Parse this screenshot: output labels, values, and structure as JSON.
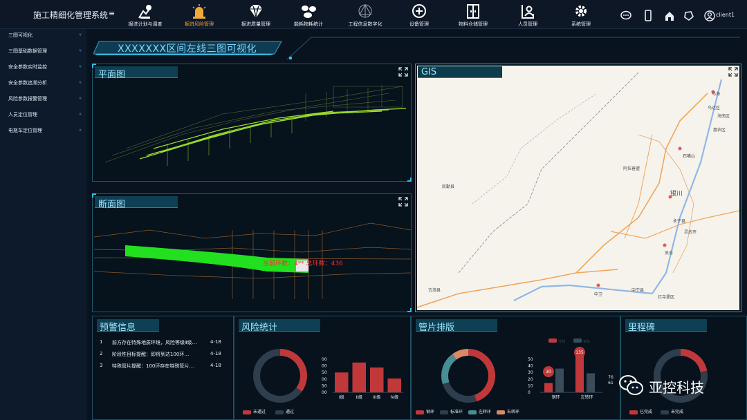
{
  "app": {
    "title": "施工精细化管理系统",
    "menu_glyph": "≡"
  },
  "nav": [
    {
      "label": "掘进计划与调度",
      "icon": "worker-icon",
      "active": false
    },
    {
      "label": "掘进风险管理",
      "icon": "alarm-light-icon",
      "active": true
    },
    {
      "label": "掘进质量管理",
      "icon": "diamond-icon",
      "active": false
    },
    {
      "label": "能耗物耗统计",
      "icon": "cylinders-icon",
      "active": false
    },
    {
      "label": "工程信息数字化",
      "icon": "network-icon",
      "active": false
    },
    {
      "label": "设备管理",
      "icon": "device-icon",
      "active": false
    },
    {
      "label": "物料仓储管理",
      "icon": "cabinet-icon",
      "active": false
    },
    {
      "label": "人员管理",
      "icon": "person-card-icon",
      "active": false
    },
    {
      "label": "系统管理",
      "icon": "gear-icon",
      "active": false
    }
  ],
  "user": {
    "name": "client1"
  },
  "sidebar": [
    {
      "label": "三图可视化"
    },
    {
      "label": "三图基础数据管理"
    },
    {
      "label": "安全参数实时监控"
    },
    {
      "label": "安全参数追溯分析"
    },
    {
      "label": "风险参数报警管理"
    },
    {
      "label": "人员定位管理"
    },
    {
      "label": "电瓶车定位管理"
    }
  ],
  "page": {
    "title": "XXXXXXX区间左线三图可视化"
  },
  "panels": {
    "plan": {
      "title": "平面图"
    },
    "section": {
      "title": "断面图",
      "overlay": "当前环数：4**    总环数：436"
    },
    "gis": {
      "title": "GIS",
      "places": [
        "乌海",
        "乌达区",
        "海南区",
        "惠农区",
        "石嘴山",
        "阿拉善盟",
        "银川",
        "永宁县",
        "灵武市",
        "吴忠",
        "民勤县",
        "古浪县",
        "中卫",
        "中宁县",
        "红寺堡区"
      ]
    }
  },
  "warnings": {
    "title": "预警信息",
    "items": [
      {
        "num": "1",
        "text": "前方存在特殊地质环境，风险等级Ⅱ级…",
        "date": "4-18"
      },
      {
        "num": "2",
        "text": "阶段性目标提醒：即将到达100环…",
        "date": "4-18"
      },
      {
        "num": "3",
        "text": "特殊管片提醒：100环存在特殊管片…",
        "date": "4-18"
      }
    ]
  },
  "risk": {
    "title": "风险统计",
    "legend": [
      "未通过",
      "通过"
    ],
    "colors": {
      "fail": "#c0383a",
      "pass": "#2f3e4c"
    },
    "donut": {
      "fail": 0.35,
      "pass": 0.65
    },
    "y_ticks": [
      "00",
      "00",
      "50",
      "00",
      "50",
      "00"
    ]
  },
  "segments": {
    "title": "管片排版",
    "legend": [
      "钢环",
      "标准环",
      "左转环",
      "右转环"
    ],
    "colors": [
      "#c0383a",
      "#2f3e4c",
      "#4a8e95",
      "#d98a64"
    ],
    "bar_legend": [
      "计划",
      "实际"
    ],
    "y_ticks": [
      "50",
      "40",
      "30",
      "20",
      "10",
      "0"
    ],
    "categories": [
      "钢环",
      "左转环"
    ],
    "labels": [
      "30",
      "135",
      "76",
      "61"
    ]
  },
  "milestone": {
    "title": "里程碑",
    "legend": [
      "已完成",
      "未完成"
    ],
    "colors": {
      "done": "#c0383a",
      "todo": "#2f3e4c"
    },
    "donut": {
      "done": 0.22,
      "todo": 0.78
    }
  },
  "chart_data": [
    {
      "type": "pie",
      "title": "风险统计",
      "labels": [
        "未通过",
        "通过"
      ],
      "values": [
        35,
        65
      ]
    },
    {
      "type": "bar",
      "title": "风险统计",
      "categories": [
        "I级",
        "II级",
        "III级",
        "IV级"
      ],
      "values": [
        0.6,
        0.9,
        0.75,
        0.42
      ]
    },
    {
      "type": "pie",
      "title": "管片排版",
      "labels": [
        "钢环",
        "标准环",
        "左转环",
        "右转环"
      ],
      "values": [
        45,
        25,
        20,
        10
      ]
    },
    {
      "type": "bar",
      "title": "管片排版",
      "categories": [
        "钢环",
        "左转环"
      ],
      "series": [
        {
          "name": "计划",
          "values": [
            30,
            135
          ]
        },
        {
          "name": "实际",
          "values": [
            76,
            61
          ]
        }
      ]
    },
    {
      "type": "pie",
      "title": "里程碑",
      "labels": [
        "已完成",
        "未完成"
      ],
      "values": [
        22,
        78
      ]
    }
  ],
  "brand": {
    "name": "亚控科技"
  }
}
